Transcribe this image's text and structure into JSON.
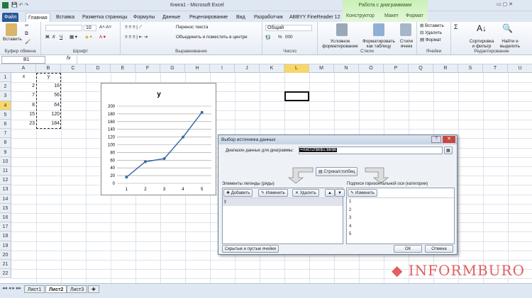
{
  "window": {
    "title": "Книга1 - Microsoft Excel",
    "context_tab": "Работа с диаграммами"
  },
  "tabs": [
    "Файл",
    "Главная",
    "Вставка",
    "Разметка страницы",
    "Формулы",
    "Данные",
    "Рецензирование",
    "Вид",
    "Разработчик",
    "ABBYY FineReader 12",
    "Конструктор",
    "Макет",
    "Формат"
  ],
  "ribbon": {
    "clipboard": {
      "paste": "Вставить",
      "label": "Буфер обмена"
    },
    "font": {
      "size": "10",
      "bold": "Ж",
      "italic": "К",
      "underline": "Ч",
      "label": "Шрифт"
    },
    "align": {
      "wrap": "Перенос текста",
      "merge": "Объединить и поместить в центре",
      "label": "Выравнивание"
    },
    "number": {
      "format": "Общий",
      "percent": "%",
      "thousands": "000",
      "label": "Число"
    },
    "styles": {
      "conditional": "Условное форматирование",
      "table": "Форматировать как таблицу",
      "cell": "Стили ячеек",
      "label": "Стили"
    },
    "cells": {
      "insert": "Вставить",
      "delete": "Удалить",
      "format": "Формат",
      "label": "Ячейки"
    },
    "editing": {
      "sort": "Сортировка и фильтр",
      "find": "Найти и выделить",
      "label": "Редактирование"
    }
  },
  "formula_bar": {
    "name_box": "B1",
    "fx": "fx",
    "value": ""
  },
  "columns": [
    "A",
    "B",
    "C",
    "D",
    "E",
    "F",
    "G",
    "H",
    "I",
    "J",
    "K",
    "L",
    "M",
    "N",
    "O",
    "P",
    "Q",
    "R",
    "S",
    "T",
    "U"
  ],
  "rows": [
    "1",
    "2",
    "3",
    "4",
    "5",
    "6",
    "7",
    "8",
    "9",
    "10",
    "11",
    "12",
    "13",
    "14",
    "15",
    "16",
    "17",
    "18",
    "19",
    "20",
    "21",
    "22"
  ],
  "cells": {
    "A": [
      "x",
      "2",
      "7",
      "8",
      "15",
      "23"
    ],
    "B": [
      "y",
      "16",
      "56",
      "64",
      "120",
      "184"
    ]
  },
  "chart_data": {
    "type": "line",
    "title": "y",
    "categories": [
      "1",
      "2",
      "3",
      "4",
      "5"
    ],
    "values": [
      16,
      56,
      64,
      120,
      184
    ],
    "ylim": [
      0,
      200
    ],
    "yticks": [
      "0",
      "20",
      "40",
      "60",
      "80",
      "100",
      "120",
      "140",
      "160",
      "180",
      "200"
    ],
    "grid": true
  },
  "dialog": {
    "title": "Выбор источника данных",
    "range_label": "Диапазон данных для диаграммы:",
    "range_value": "=Лист2!$B$1:$B$6",
    "switch": "Строка/столбец",
    "legend_label": "Элементы легенды (ряды)",
    "add": "Добавить",
    "edit": "Изменить",
    "remove": "Удалить",
    "series": [
      "y"
    ],
    "axis_label": "Подписи горизонтальной оси (категории)",
    "axis_edit": "Изменить",
    "categories": [
      "1",
      "2",
      "3",
      "4",
      "5"
    ],
    "hidden": "Скрытые и пустые ячейки",
    "ok": "ОК",
    "cancel": "Отмена"
  },
  "sheets": [
    "Лист1",
    "Лист2",
    "Лист3"
  ],
  "watermark": "INFORMBURO"
}
